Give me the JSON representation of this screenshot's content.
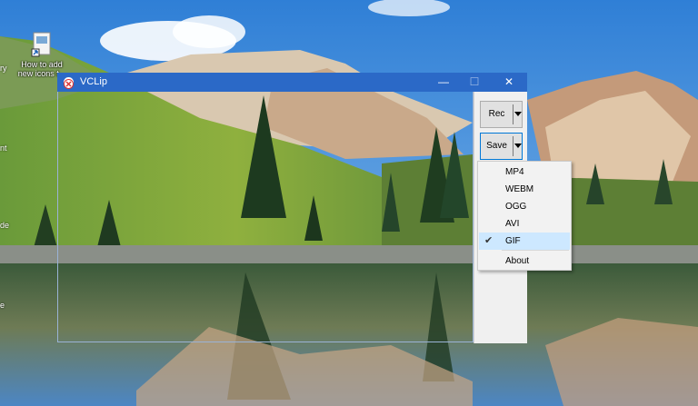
{
  "desktop": {
    "icon_label_line1": "How to add",
    "icon_label_line2": "new icons t...",
    "edge_fragments": [
      "ry",
      "nt",
      "de",
      "e"
    ]
  },
  "window": {
    "title": "VCLip",
    "minimize_glyph": "—",
    "maximize_glyph": "☐",
    "close_glyph": "✕"
  },
  "panel": {
    "rec_label": "Rec",
    "save_label": "Save"
  },
  "save_menu": {
    "items": [
      {
        "label": "MP4",
        "checked": false
      },
      {
        "label": "WEBM",
        "checked": false
      },
      {
        "label": "OGG",
        "checked": false
      },
      {
        "label": "AVI",
        "checked": false
      },
      {
        "label": "GIF",
        "checked": true
      }
    ],
    "check_glyph": "✔",
    "about_label": "About"
  },
  "colors": {
    "titlebar": "#2b69c7",
    "checked_bg": "#cde8ff",
    "focus_border": "#0078d7"
  }
}
